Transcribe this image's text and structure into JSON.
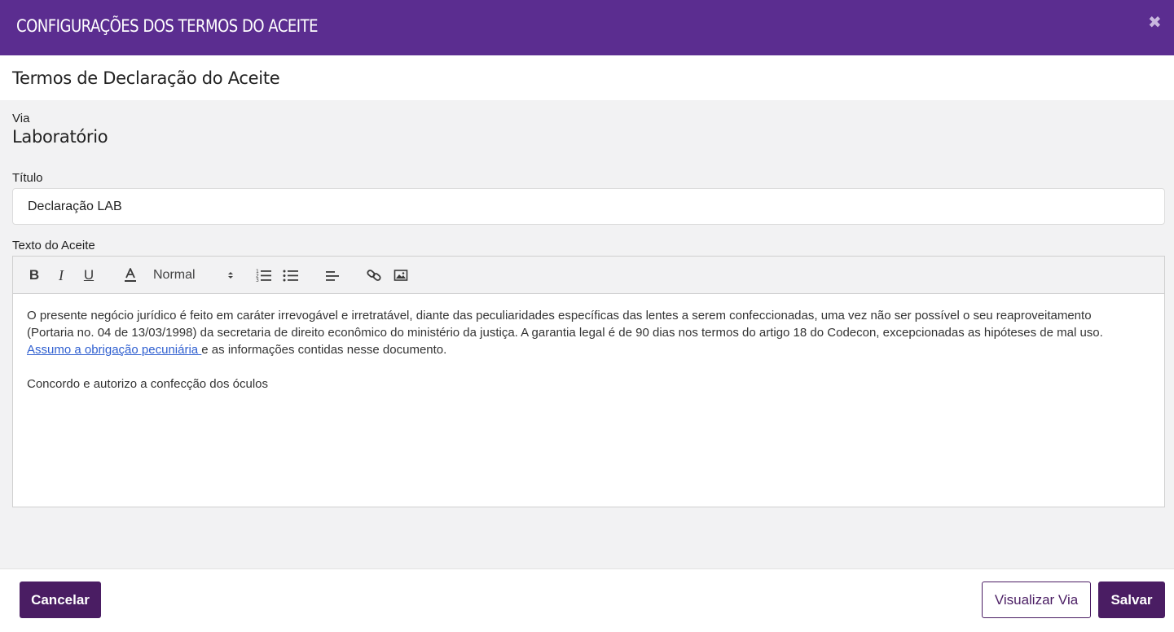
{
  "window": {
    "title": "CONFIGURAÇÕES DOS TERMOS DO ACEITE",
    "close_symbol": "✖"
  },
  "section": {
    "title": "Termos de Declaração do Aceite"
  },
  "form": {
    "via_label": "Via",
    "via_value": "Laboratório",
    "titulo_label": "Título",
    "titulo_value": "Declaração LAB",
    "texto_label": "Texto do Aceite"
  },
  "editor": {
    "toolbar": {
      "bold": "B",
      "italic": "I",
      "underline": "U",
      "size": "Normal",
      "icons": [
        "text-color-icon",
        "ordered-list-icon",
        "bullet-list-icon",
        "align-left-icon",
        "link-icon",
        "image-icon"
      ]
    },
    "content": {
      "p1_before_link": "O presente negócio jurídico é feito em caráter irrevogável e irretratável, diante das peculiaridades específicas das lentes a serem confeccionadas, uma vez não ser possível o seu reaproveitamento (Portaria no. 04 de 13/03/1998) da secretaria de direito econômico do ministério da justiça. A garantia legal é de 90 dias nos termos do artigo 18 do Codecon, excepcionadas as hipóteses de mal uso. ",
      "p1_link": "Assumo a obrigação pecuniária ",
      "p1_after_link": "e as informações contidas nesse documento.",
      "p2": "Concordo e autorizo a confecção dos óculos"
    }
  },
  "footer": {
    "cancel_label": "Cancelar",
    "preview_label": "Visualizar Via",
    "save_label": "Salvar"
  },
  "colors": {
    "header_bg": "#5b2d90",
    "button_bg": "#4a1d63",
    "link": "#2f5fd0"
  }
}
